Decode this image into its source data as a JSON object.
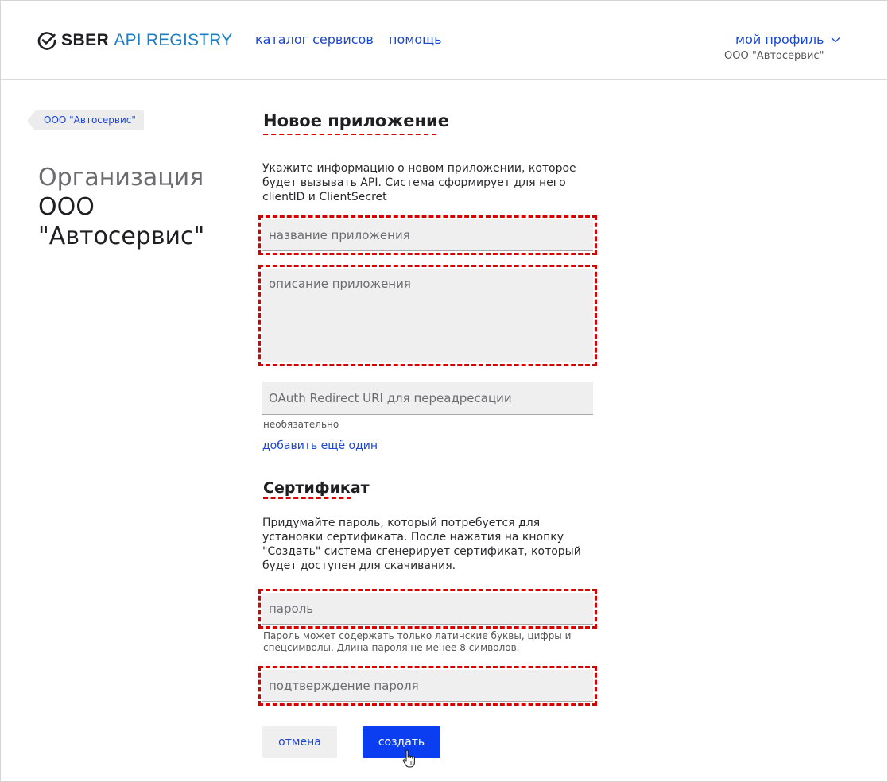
{
  "header": {
    "logo_sber": "SBER",
    "logo_api": "API REGISTRY",
    "nav": {
      "catalog": "каталог сервисов",
      "help": "помощь"
    },
    "profile": {
      "label": "мой профиль",
      "org": "ООО \"Автосервис\""
    }
  },
  "sidebar": {
    "breadcrumb": "ООО \"Автосервис\"",
    "org_line1": "Организация",
    "org_line2": "ООО",
    "org_line3": "\"Автосервис\""
  },
  "form": {
    "title": "Новое приложение",
    "intro": "Укажите информацию о новом приложении, которое будет вызывать API. Система сформирует для него clientID и ClientSecret",
    "name_placeholder": "название приложения",
    "description_placeholder": "описание приложения",
    "uri_placeholder": "OAuth Redirect URI для переадресации",
    "uri_hint": "необязательно",
    "add_more": "добавить ещё один",
    "cert_title": "Сертификат",
    "cert_intro": "Придумайте пароль, который потребуется для установки сертификата. После нажатия на кнопку \"Создать\" система сгенерирует сертификат, который будет доступен для скачивания.",
    "password_placeholder": "пароль",
    "password_hint": "Пароль может содержать только латинские буквы, цифры и спецсимволы. Длина пароля не менее 8 символов.",
    "confirm_placeholder": "подтверждение пароля",
    "cancel_label": "отмена",
    "create_label": "создать"
  },
  "colors": {
    "accent": "#1a47d4",
    "primary_button": "#0a3ef0",
    "logo_api": "#1d7fc7",
    "highlight": "#d90000"
  }
}
